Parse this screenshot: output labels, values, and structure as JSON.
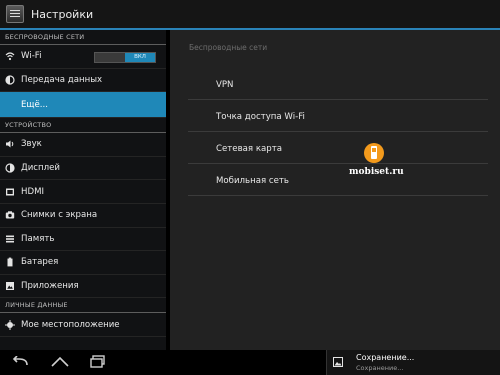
{
  "app": {
    "title": "Настройки"
  },
  "sidebar": {
    "section_wireless": "БЕСПРОВОДНЫЕ СЕТИ",
    "wifi_label": "Wi-Fi",
    "wifi_toggle": "ВКЛ",
    "data_label": "Передача данных",
    "more_label": "Ещё...",
    "section_device": "УСТРОЙСТВО",
    "sound_label": "Звук",
    "display_label": "Дисплей",
    "hdmi_label": "HDMI",
    "screenshots_label": "Снимки с экрана",
    "storage_label": "Память",
    "battery_label": "Батарея",
    "apps_label": "Приложения",
    "section_personal": "ЛИЧНЫЕ ДАННЫЕ",
    "location_label": "Мое местоположение"
  },
  "detail": {
    "header": "Беспроводные сети",
    "items": [
      "VPN",
      "Точка доступа Wi-Fi",
      "Сетевая карта",
      "Мобильная сеть"
    ]
  },
  "watermark": {
    "text": "mobiset.ru",
    "accent": "#f39a1c"
  },
  "notification": {
    "title": "Сохранение...",
    "subtitle": "Сохранение..."
  },
  "colors": {
    "accent": "#1f88b8",
    "actionbar_line": "#2a83b8"
  }
}
